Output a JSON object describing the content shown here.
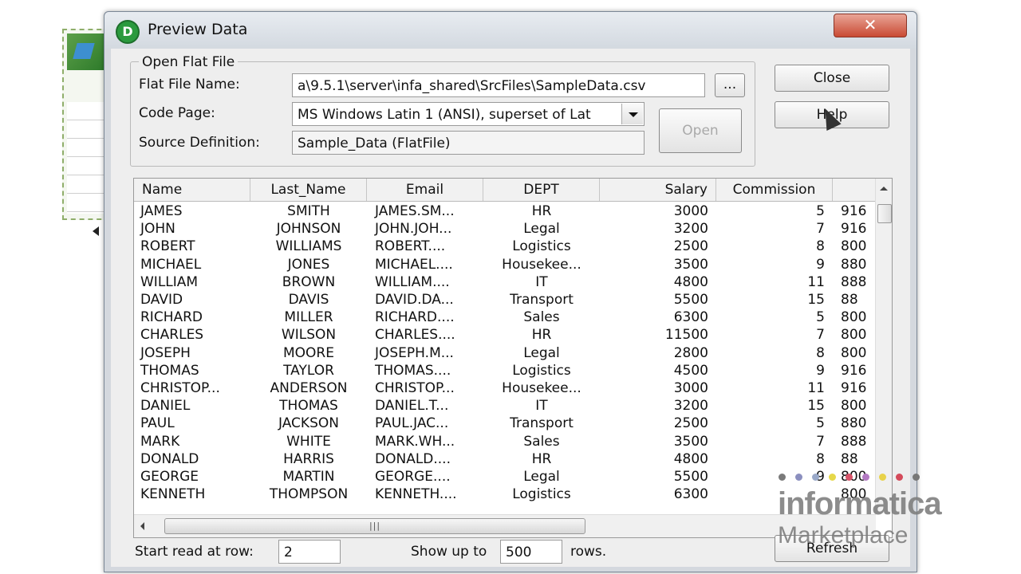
{
  "window": {
    "title": "Preview Data",
    "close_glyph": "✕"
  },
  "group": {
    "legend": "Open Flat File",
    "flat_file_label": "Flat File Name:",
    "flat_file_value": "a\\9.5.1\\server\\infa_shared\\SrcFiles\\SampleData.csv",
    "browse_label": "...",
    "code_page_label": "Code Page:",
    "code_page_value": "MS Windows Latin 1 (ANSI), superset of Lat",
    "source_def_label": "Source Definition:",
    "source_def_value": "Sample_Data (FlatFile)",
    "open_label": "Open"
  },
  "buttons": {
    "close": "Close",
    "help": "Help"
  },
  "grid": {
    "columns": [
      "Name",
      "Last_Name",
      "Email",
      "DEPT",
      "Salary",
      "Commission"
    ],
    "rows": [
      [
        "JAMES",
        "SMITH",
        "JAMES.SM...",
        "HR",
        "3000",
        "5",
        "916"
      ],
      [
        "JOHN",
        "JOHNSON",
        "JOHN.JOH...",
        "Legal",
        "3200",
        "7",
        "916"
      ],
      [
        "ROBERT",
        "WILLIAMS",
        "ROBERT....",
        "Logistics",
        "2500",
        "8",
        "800"
      ],
      [
        "MICHAEL",
        "JONES",
        "MICHAEL....",
        "Housekee...",
        "3500",
        "9",
        "880"
      ],
      [
        "WILLIAM",
        "BROWN",
        "WILLIAM....",
        "IT",
        "4800",
        "11",
        "888"
      ],
      [
        "DAVID",
        "DAVIS",
        "DAVID.DA...",
        "Transport",
        "5500",
        "15",
        "88"
      ],
      [
        "RICHARD",
        "MILLER",
        "RICHARD....",
        "Sales",
        "6300",
        "5",
        "800"
      ],
      [
        "CHARLES",
        "WILSON",
        "CHARLES....",
        "HR",
        "11500",
        "7",
        "800"
      ],
      [
        "JOSEPH",
        "MOORE",
        "JOSEPH.M...",
        "Legal",
        "2800",
        "8",
        "800"
      ],
      [
        "THOMAS",
        "TAYLOR",
        "THOMAS....",
        "Logistics",
        "4500",
        "9",
        "916"
      ],
      [
        "CHRISTOP...",
        "ANDERSON",
        "CHRISTOP...",
        "Housekee...",
        "3000",
        "11",
        "916"
      ],
      [
        "DANIEL",
        "THOMAS",
        "DANIEL.T...",
        "IT",
        "3200",
        "15",
        "800"
      ],
      [
        "PAUL",
        "JACKSON",
        "PAUL.JAC...",
        "Transport",
        "2500",
        "5",
        "880"
      ],
      [
        "MARK",
        "WHITE",
        "MARK.WH...",
        "Sales",
        "3500",
        "7",
        "888"
      ],
      [
        "DONALD",
        "HARRIS",
        "DONALD....",
        "HR",
        "4800",
        "8",
        "88"
      ],
      [
        "GEORGE",
        "MARTIN",
        "GEORGE....",
        "Legal",
        "5500",
        "9",
        "800"
      ],
      [
        "KENNETH",
        "THOMPSON",
        "KENNETH....",
        "Logistics",
        "6300",
        "",
        "800"
      ]
    ]
  },
  "footer": {
    "start_label": "Start read at row:",
    "start_value": "2",
    "show_label": "Show up to",
    "show_value": "500",
    "rows_label": "rows.",
    "refresh_label": "Refresh"
  },
  "watermark": {
    "title": "informatica",
    "subtitle": "Marketplace"
  },
  "colors": {
    "titlebar": "#dfe4ea",
    "close_button": "#c94a33",
    "app_icon": "#2b9a3e"
  },
  "icons": {
    "app": "informatica-d-icon",
    "scroll_thumb_grip": "|||"
  }
}
